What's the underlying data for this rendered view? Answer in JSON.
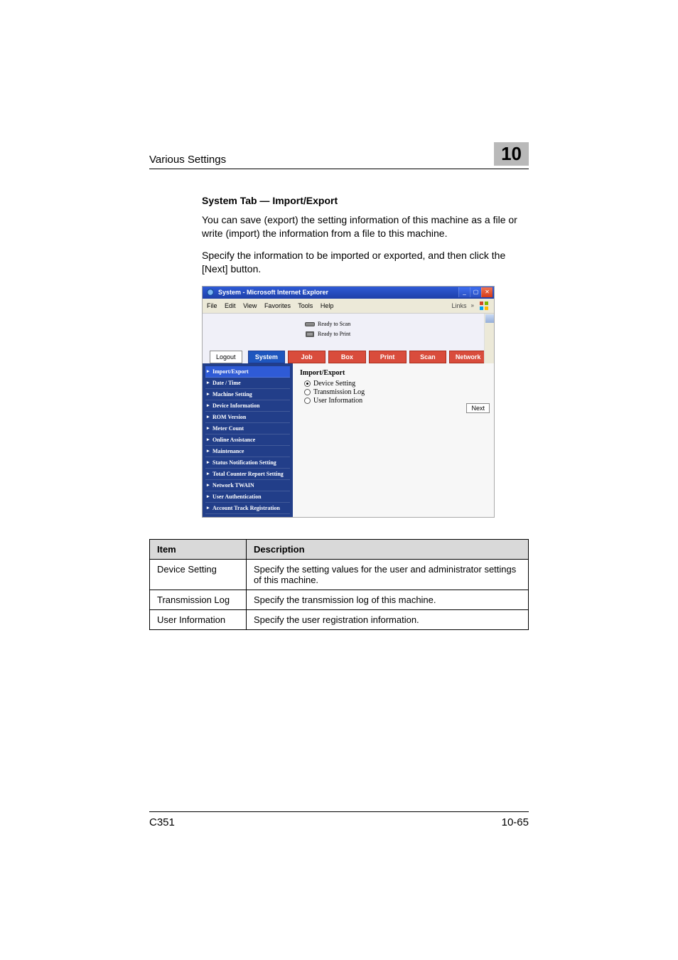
{
  "header": {
    "left": "Various Settings",
    "chapter": "10"
  },
  "section": {
    "title": "System Tab — Import/Export",
    "para1": "You can save (export) the setting information of this machine as a file or write (import) the information from a file to this machine.",
    "para2": "Specify the information to be imported or exported, and then click the [Next] button."
  },
  "screenshot": {
    "window_title": "System - Microsoft Internet Explorer",
    "menus": [
      "File",
      "Edit",
      "View",
      "Favorites",
      "Tools",
      "Help"
    ],
    "links_label": "Links",
    "status": {
      "scan": "Ready to Scan",
      "print": "Ready to Print"
    },
    "logout": "Logout",
    "tabs": [
      "System",
      "Job",
      "Box",
      "Print",
      "Scan",
      "Network"
    ],
    "sidebar": [
      "Import/Export",
      "Date / Time",
      "Machine Setting",
      "Device Information",
      "ROM Version",
      "Meter Count",
      "Online Assistance",
      "Maintenance",
      "Status Notification Setting",
      "Total Counter Report Setting",
      "Network TWAIN",
      "User Authentication",
      "Account Track Registration"
    ],
    "content_title": "Import/Export",
    "options": [
      "Device Setting",
      "Transmission Log",
      "User Information"
    ],
    "selected_index": 0,
    "next_label": "Next"
  },
  "table": {
    "headers": [
      "Item",
      "Description"
    ],
    "rows": [
      [
        "Device Setting",
        "Specify the setting values for the user and administrator settings of this machine."
      ],
      [
        "Transmission Log",
        "Specify the transmission log of this machine."
      ],
      [
        "User Information",
        "Specify the user registration information."
      ]
    ]
  },
  "footer": {
    "left": "C351",
    "right": "10-65"
  }
}
